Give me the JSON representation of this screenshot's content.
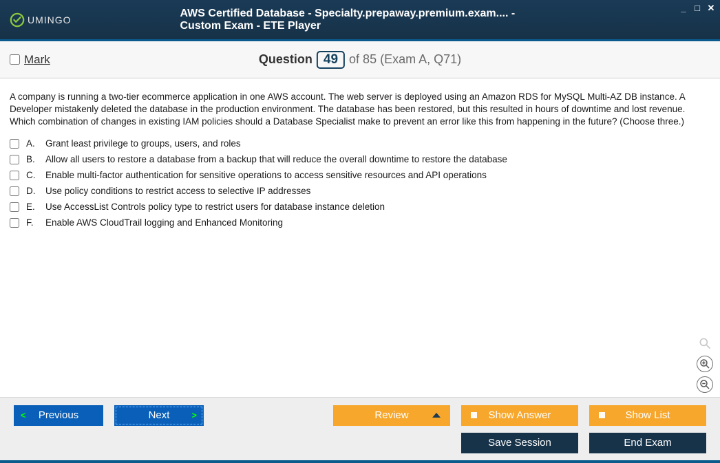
{
  "window": {
    "title": "AWS Certified Database - Specialty.prepaway.premium.exam.... - Custom Exam - ETE Player",
    "logo_text": "UMINGO"
  },
  "win_controls": {
    "min": "_",
    "max": "□",
    "close": "✕"
  },
  "mark": {
    "label": "Mark",
    "checked": false
  },
  "question_bar": {
    "label": "Question",
    "number": "49",
    "of_text": "of 85 (Exam A, Q71)"
  },
  "question": {
    "stem": "A company is running a two-tier ecommerce application in one AWS account. The web server is deployed using an Amazon RDS for MySQL Multi-AZ DB instance. A Developer mistakenly deleted the database in the production environment. The database has been restored, but this resulted in hours of downtime and lost revenue. Which combination of changes in existing IAM policies should a Database Specialist make to prevent an error like this from happening in the future? (Choose three.)",
    "options": [
      {
        "letter": "A.",
        "text": "Grant least privilege to groups, users, and roles"
      },
      {
        "letter": "B.",
        "text": "Allow all users to restore a database from a backup that will reduce the overall downtime to restore the database"
      },
      {
        "letter": "C.",
        "text": "Enable multi-factor authentication for sensitive operations to access sensitive resources and API operations"
      },
      {
        "letter": "D.",
        "text": "Use policy conditions to restrict access to selective IP addresses"
      },
      {
        "letter": "E.",
        "text": "Use AccessList Controls policy type to restrict users for database instance deletion"
      },
      {
        "letter": "F.",
        "text": "Enable AWS CloudTrail logging and Enhanced Monitoring"
      }
    ]
  },
  "footer": {
    "previous": "Previous",
    "next": "Next",
    "review": "Review",
    "show_answer": "Show Answer",
    "show_list": "Show List",
    "save_session": "Save Session",
    "end_exam": "End Exam"
  },
  "zoom": {
    "search": "search-icon",
    "in": "+",
    "out": "−"
  }
}
